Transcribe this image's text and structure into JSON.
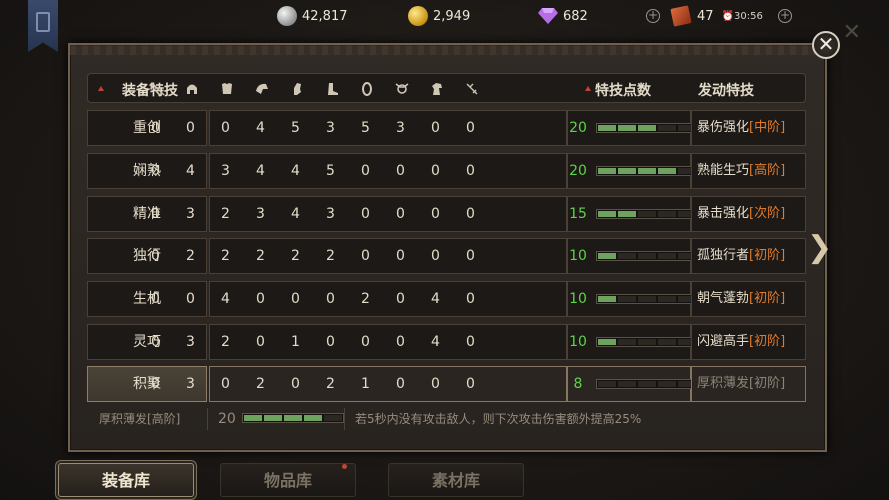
{
  "currency": {
    "silver": "42,817",
    "gold": "2,949",
    "gems": "682",
    "tickets": "47",
    "time": "30:56"
  },
  "table": {
    "header_title": "装备特技",
    "header_points": "特技点数",
    "header_skill": "发动特技",
    "slot_icons": [
      "sword-icon",
      "helmet-icon",
      "armor-icon",
      "pauldron-icon",
      "gauntlet-icon",
      "boots-icon",
      "ring-icon",
      "amulet-icon",
      "horse-icon",
      "scroll-icon"
    ],
    "rows": [
      {
        "name": "重创",
        "vals": [
          "0",
          "0",
          "0",
          "4",
          "5",
          "3",
          "5",
          "3",
          "0",
          "0"
        ],
        "points": "20",
        "filled": 3,
        "skill": "暴伤强化",
        "tier": "[中阶]"
      },
      {
        "name": "娴熟",
        "vals": [
          "0",
          "4",
          "3",
          "4",
          "4",
          "5",
          "0",
          "0",
          "0",
          "0"
        ],
        "points": "20",
        "filled": 4,
        "skill": "熟能生巧",
        "tier": "[高阶]"
      },
      {
        "name": "精准",
        "vals": [
          "0",
          "3",
          "2",
          "3",
          "4",
          "3",
          "0",
          "0",
          "0",
          "0"
        ],
        "points": "15",
        "filled": 2,
        "skill": "暴击强化",
        "tier": "[次阶]"
      },
      {
        "name": "独行",
        "vals": [
          "0",
          "2",
          "2",
          "2",
          "2",
          "2",
          "0",
          "0",
          "0",
          "0"
        ],
        "points": "10",
        "filled": 1,
        "skill": "孤独行者",
        "tier": "[初阶]"
      },
      {
        "name": "生机",
        "vals": [
          "0",
          "0",
          "4",
          "0",
          "0",
          "0",
          "2",
          "0",
          "4",
          "0"
        ],
        "points": "10",
        "filled": 1,
        "skill": "朝气蓬勃",
        "tier": "[初阶]"
      },
      {
        "name": "灵巧",
        "vals": [
          "0",
          "3",
          "2",
          "0",
          "1",
          "0",
          "0",
          "0",
          "4",
          "0"
        ],
        "points": "10",
        "filled": 1,
        "skill": "闪避高手",
        "tier": "[初阶]"
      },
      {
        "name": "积聚",
        "vals": [
          "0",
          "3",
          "0",
          "2",
          "0",
          "2",
          "1",
          "0",
          "0",
          "0"
        ],
        "points": "8",
        "filled": 0,
        "skill": "厚积薄发",
        "tier": "[初阶]",
        "selected": true
      }
    ]
  },
  "footer": {
    "skill": "厚积薄发[高阶]",
    "points": "20",
    "filled": 4,
    "desc": "若5秒内没有攻击敌人，则下次攻击伤害额外提高25%"
  },
  "tabs": [
    "装备库",
    "物品库",
    "素材库"
  ],
  "colors": {
    "points_green": "#5fd34a",
    "tier_orange": "#e07b2b",
    "bar_fill": "#6ea35f"
  }
}
